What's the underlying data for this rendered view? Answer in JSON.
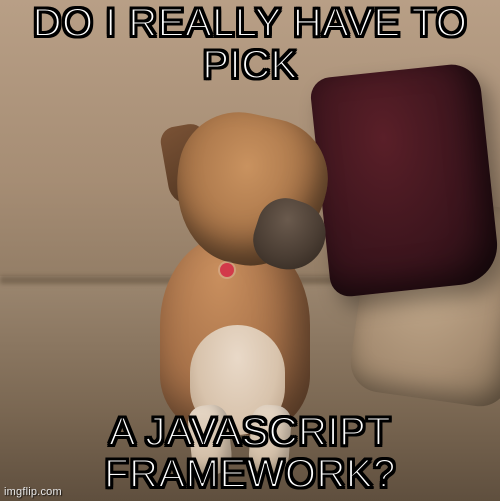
{
  "meme": {
    "top_text": "DO I REALLY HAVE TO PICK",
    "bottom_text": "A JAVASCRIPT FRAMEWORK?",
    "watermark": "imgflip.com"
  }
}
